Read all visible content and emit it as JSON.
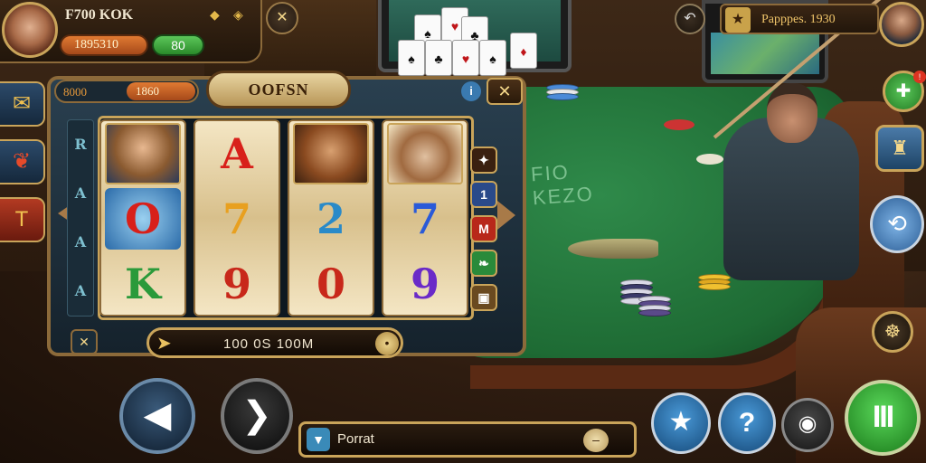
{
  "player": {
    "name": "F700 KOK",
    "coins": "1895310",
    "gems": "80"
  },
  "top_right": {
    "label": "Papppes. 1930"
  },
  "slot": {
    "title": "OOFSN",
    "coin_label": "8000",
    "coin_value": "1860",
    "bet_text": "100 0S 100M",
    "reels": [
      [
        "portrait-woman",
        "O",
        "K"
      ],
      [
        "A",
        "7",
        "9"
      ],
      [
        "portrait-pilot",
        "2",
        "0"
      ],
      [
        "portrait-captain",
        "7",
        "9"
      ]
    ],
    "left_strip": [
      "R",
      "A",
      "A",
      "A"
    ],
    "right_strip": [
      "1",
      "M",
      "",
      ""
    ]
  },
  "chat": {
    "placeholder": "Porrat"
  },
  "icons": {
    "hud_menu": "crossed-tools-icon",
    "back": "back-arrow-icon",
    "prev": "triangle-left-icon",
    "next": "chevron-right-icon",
    "star": "star-icon",
    "help": "question-icon",
    "camera": "webcam-icon",
    "pause": "pause-bars-icon"
  },
  "colors": {
    "felt": "#2f8a4a",
    "gold_trim": "#c9a45a",
    "coins_orange": "#e07a32",
    "gems_green": "#5cc65a"
  }
}
